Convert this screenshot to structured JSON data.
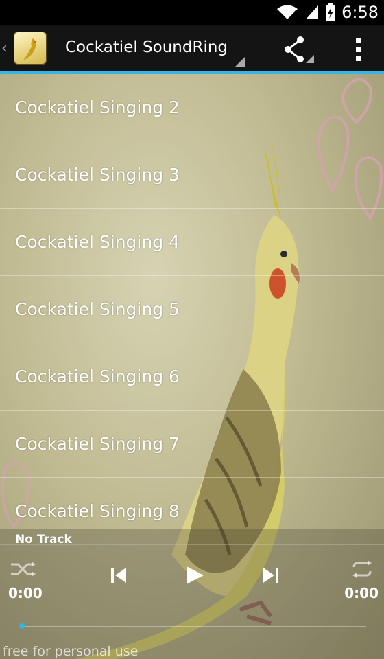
{
  "status_bar": {
    "time": "6:58"
  },
  "action_bar": {
    "title": "Cockatiel SoundRing"
  },
  "tracks": [
    "Cockatiel Singing 2",
    "Cockatiel Singing 3",
    "Cockatiel Singing 4",
    "Cockatiel Singing 5",
    "Cockatiel Singing 6",
    "Cockatiel Singing 7",
    "Cockatiel Singing 8"
  ],
  "player": {
    "now_playing": "No Track",
    "time_elapsed": "0:00",
    "time_total": "0:00",
    "progress": 0
  },
  "footer": {
    "note": "free for personal use"
  },
  "colors": {
    "accent": "#33b5e5",
    "action_bar": "#141414"
  }
}
